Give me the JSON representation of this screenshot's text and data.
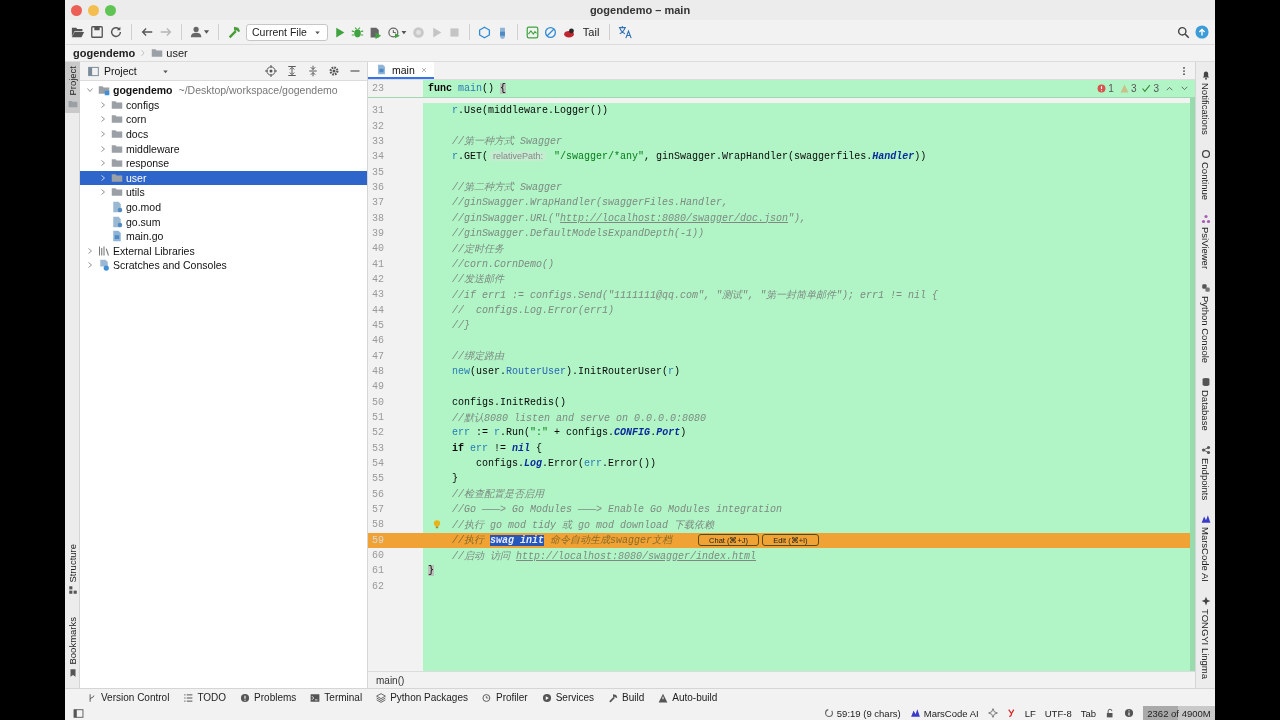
{
  "window": {
    "title": "gogendemo – main"
  },
  "toolbar": {
    "run_config": "Current File",
    "tail_label": "Tail"
  },
  "navbar": [
    {
      "label": "gogendemo",
      "kind": "project"
    },
    {
      "label": "user",
      "kind": "folder"
    }
  ],
  "left_stripe": {
    "top": [
      {
        "label": "Project",
        "selected": true
      }
    ],
    "bottom": [
      {
        "label": "Structure",
        "selected": false
      },
      {
        "label": "Bookmarks",
        "selected": false
      }
    ]
  },
  "project_panel": {
    "title": "Project",
    "tree": [
      {
        "label": "gogendemo",
        "path": "~/Desktop/workspace/gogendemo",
        "kind": "module",
        "expanded": true,
        "selected": false,
        "children": [
          {
            "label": "configs",
            "kind": "folder",
            "expanded": false,
            "selected": false
          },
          {
            "label": "corn",
            "kind": "folder",
            "expanded": false,
            "selected": false
          },
          {
            "label": "docs",
            "kind": "folder",
            "expanded": false,
            "selected": false
          },
          {
            "label": "middleware",
            "kind": "folder",
            "expanded": false,
            "selected": false
          },
          {
            "label": "response",
            "kind": "folder",
            "expanded": false,
            "selected": false
          },
          {
            "label": "user",
            "kind": "folder",
            "expanded": false,
            "selected": true
          },
          {
            "label": "utils",
            "kind": "folder",
            "expanded": false,
            "selected": false
          },
          {
            "label": "go.mod",
            "kind": "modfile",
            "selected": false
          },
          {
            "label": "go.sum",
            "kind": "modfile",
            "selected": false
          },
          {
            "label": "main.go",
            "kind": "gofile",
            "selected": false
          }
        ]
      },
      {
        "label": "External Libraries",
        "kind": "library",
        "expanded": false,
        "selected": false
      },
      {
        "label": "Scratches and Consoles",
        "kind": "scratches",
        "expanded": false,
        "selected": false
      }
    ]
  },
  "editor": {
    "tabs": [
      {
        "label": "main",
        "selected": true
      }
    ],
    "sticky_line": {
      "number": "23",
      "tokens": [
        {
          "text": "func ",
          "kind": "keyword"
        },
        {
          "text": "main",
          "kind": "function"
        },
        {
          "text": "() ",
          "kind": "plain"
        },
        {
          "text": "{",
          "kind": "match"
        }
      ]
    },
    "inspections": {
      "errors": "1",
      "warnings": "3",
      "typos": "3"
    },
    "lines": [
      {
        "number": "31",
        "current": false,
        "bulb": false,
        "tokens": [
          {
            "text": "    r",
            "kind": "variable"
          },
          {
            "text": ".Use(middleware.Logger())",
            "kind": "plain"
          }
        ]
      },
      {
        "number": "32",
        "current": false,
        "bulb": false
      },
      {
        "number": "33",
        "current": false,
        "bulb": false,
        "tokens": [
          {
            "text": "    //第一种方式 Swagger",
            "kind": "comment"
          }
        ]
      },
      {
        "number": "34",
        "current": false,
        "bulb": false,
        "tokens": [
          {
            "text": "    r",
            "kind": "variable"
          },
          {
            "text": ".GET(",
            "kind": "plain"
          },
          {
            "text": "relativePath:",
            "kind": "hint"
          },
          {
            "text": " \"/swagger/*any\"",
            "kind": "string"
          },
          {
            "text": ", ginSwagger.WrapHandler(swaggerfiles.",
            "kind": "plain"
          },
          {
            "text": "Handler",
            "kind": "constant"
          },
          {
            "text": "))",
            "kind": "plain"
          }
        ]
      },
      {
        "number": "35",
        "current": false,
        "bulb": false
      },
      {
        "number": "36",
        "current": false,
        "bulb": false,
        "tokens": [
          {
            "text": "    //第二种方式 Swagger",
            "kind": "comment"
          }
        ]
      },
      {
        "number": "37",
        "current": false,
        "bulb": false,
        "tokens": [
          {
            "text": "    //ginSwagger.WrapHandler(swaggerFiles.Handler,",
            "kind": "comment"
          }
        ]
      },
      {
        "number": "38",
        "current": false,
        "bulb": false,
        "tokens": [
          {
            "text": "    //ginSwagger.URL(\"",
            "kind": "comment"
          },
          {
            "text": "http://localhost:8080/swagger/doc.json",
            "kind": "link"
          },
          {
            "text": "\"),",
            "kind": "comment"
          }
        ]
      },
      {
        "number": "39",
        "current": false,
        "bulb": false,
        "tokens": [
          {
            "text": "    //ginSwagger.DefaultModelsExpandDepth(-1))",
            "kind": "comment"
          }
        ]
      },
      {
        "number": "40",
        "current": false,
        "bulb": false,
        "tokens": [
          {
            "text": "    //定时任务",
            "kind": "comment"
          }
        ]
      },
      {
        "number": "41",
        "current": false,
        "bulb": false,
        "tokens": [
          {
            "text": "    //corn.CornDemo()",
            "kind": "comment"
          }
        ]
      },
      {
        "number": "42",
        "current": false,
        "bulb": false,
        "tokens": [
          {
            "text": "    //发送邮件",
            "kind": "comment"
          }
        ]
      },
      {
        "number": "43",
        "current": false,
        "bulb": false,
        "tokens": [
          {
            "text": "    //if err1 := configs.Send(\"1111111@qq.com\", \"测试\", \"第一封简单邮件\"); err1 != nil {",
            "kind": "comment"
          }
        ]
      },
      {
        "number": "44",
        "current": false,
        "bulb": false,
        "tokens": [
          {
            "text": "    //  configs.Log.Error(err1)",
            "kind": "comment"
          }
        ]
      },
      {
        "number": "45",
        "current": false,
        "bulb": false,
        "tokens": [
          {
            "text": "    //}",
            "kind": "comment"
          }
        ]
      },
      {
        "number": "46",
        "current": false,
        "bulb": false
      },
      {
        "number": "47",
        "current": false,
        "bulb": false,
        "tokens": [
          {
            "text": "    //绑定路由",
            "kind": "comment"
          }
        ]
      },
      {
        "number": "48",
        "current": false,
        "bulb": false,
        "tokens": [
          {
            "text": "    new",
            "kind": "function"
          },
          {
            "text": "(user.",
            "kind": "plain"
          },
          {
            "text": "RouterUser",
            "kind": "type"
          },
          {
            "text": ").InitRouterUser(",
            "kind": "plain"
          },
          {
            "text": "r",
            "kind": "variable"
          },
          {
            "text": ")",
            "kind": "plain"
          }
        ]
      },
      {
        "number": "49",
        "current": false,
        "bulb": false
      },
      {
        "number": "50",
        "current": false,
        "bulb": false,
        "tokens": [
          {
            "text": "    configs.InitRedis()",
            "kind": "plain"
          }
        ]
      },
      {
        "number": "51",
        "current": false,
        "bulb": false,
        "tokens": [
          {
            "text": "    //默认8080 listen and serve on 0.0.0.0:8080",
            "kind": "comment"
          }
        ]
      },
      {
        "number": "52",
        "current": false,
        "bulb": false,
        "tokens": [
          {
            "text": "    err",
            "kind": "variable"
          },
          {
            "text": " := ",
            "kind": "plain"
          },
          {
            "text": "r",
            "kind": "variable"
          },
          {
            "text": ".Run(",
            "kind": "plain"
          },
          {
            "text": "\":\"",
            "kind": "string"
          },
          {
            "text": " + configs.",
            "kind": "plain"
          },
          {
            "text": "CONFIG",
            "kind": "constant"
          },
          {
            "text": ".",
            "kind": "plain"
          },
          {
            "text": "Port",
            "kind": "constant"
          },
          {
            "text": ")",
            "kind": "plain"
          }
        ]
      },
      {
        "number": "53",
        "current": false,
        "bulb": false,
        "tokens": [
          {
            "text": "    if ",
            "kind": "keyword"
          },
          {
            "text": "err",
            "kind": "variable"
          },
          {
            "text": " != ",
            "kind": "plain"
          },
          {
            "text": "nil",
            "kind": "constant"
          },
          {
            "text": " {",
            "kind": "plain"
          }
        ]
      },
      {
        "number": "54",
        "current": false,
        "bulb": false,
        "tokens": [
          {
            "text": "        configs.",
            "kind": "plain"
          },
          {
            "text": "Log",
            "kind": "constant"
          },
          {
            "text": ".Error(",
            "kind": "plain"
          },
          {
            "text": "err",
            "kind": "variable"
          },
          {
            "text": ".Error())",
            "kind": "plain"
          }
        ]
      },
      {
        "number": "55",
        "current": false,
        "bulb": false,
        "tokens": [
          {
            "text": "    }",
            "kind": "plain"
          }
        ]
      },
      {
        "number": "56",
        "current": false,
        "bulb": false,
        "tokens": [
          {
            "text": "    //检查配置是否启用",
            "kind": "comment"
          }
        ]
      },
      {
        "number": "57",
        "current": false,
        "bulb": false,
        "tokens": [
          {
            "text": "    //Go ———> Go Modules ———> Enable Go Modules integration",
            "kind": "comment"
          }
        ]
      },
      {
        "number": "58",
        "current": false,
        "bulb": true,
        "tokens": [
          {
            "text": "    //执行 go mod tidy 或 go mod download 下载依赖",
            "kind": "comment"
          }
        ]
      },
      {
        "number": "59",
        "current": true,
        "bulb": false,
        "tokens": [
          {
            "text": "    //执行 ",
            "kind": "comment"
          },
          {
            "text": "swag init",
            "kind": "selection"
          },
          {
            "text": " 命令自动生成swagger文档",
            "kind": "comment"
          }
        ],
        "actions": [
          "Chat (⌘+J)",
          "Edit (⌘+I)"
        ]
      },
      {
        "number": "60",
        "current": false,
        "bulb": false,
        "tokens": [
          {
            "text": "    //启动 访问 ",
            "kind": "comment"
          },
          {
            "text": "http://localhost:8080/swagger/index.html",
            "kind": "link"
          }
        ]
      },
      {
        "number": "61",
        "current": false,
        "bulb": false,
        "tokens": [
          {
            "text": "}",
            "kind": "match"
          }
        ]
      },
      {
        "number": "62",
        "current": false,
        "bulb": false
      }
    ],
    "breadcrumb": "main()"
  },
  "right_stripe": [
    {
      "label": "Notifications",
      "kind": "bell"
    },
    {
      "label": "Continue",
      "kind": "continue"
    },
    {
      "label": "PsiViewer",
      "kind": "psi"
    },
    {
      "label": "Python Console",
      "kind": "python"
    },
    {
      "label": "Database",
      "kind": "database"
    },
    {
      "label": "Endpoints",
      "kind": "endpoints"
    },
    {
      "label": "MarsCode AI",
      "kind": "marscode"
    },
    {
      "label": "TONGYI Lingma",
      "kind": "lingma"
    }
  ],
  "tool_windows": [
    {
      "label": "Version Control",
      "kind": "vcs"
    },
    {
      "label": "TODO",
      "kind": "todo"
    },
    {
      "label": "Problems",
      "kind": "problems"
    },
    {
      "label": "Terminal",
      "kind": "terminal"
    },
    {
      "label": "Python Packages",
      "kind": "packages"
    },
    {
      "label": "Profiler",
      "kind": "profiler"
    },
    {
      "label": "Services",
      "kind": "services"
    },
    {
      "label": "Build",
      "kind": "build"
    },
    {
      "label": "Auto-build",
      "kind": "autobuild"
    }
  ],
  "status_bar": {
    "position": "59:19 (9 chars)",
    "assistant": "MarsCode AI",
    "line_separator": "LF",
    "encoding": "UTF-8",
    "indent": "Tab",
    "memory": {
      "reading": "2362 of 4900M",
      "level": 0.48
    }
  }
}
